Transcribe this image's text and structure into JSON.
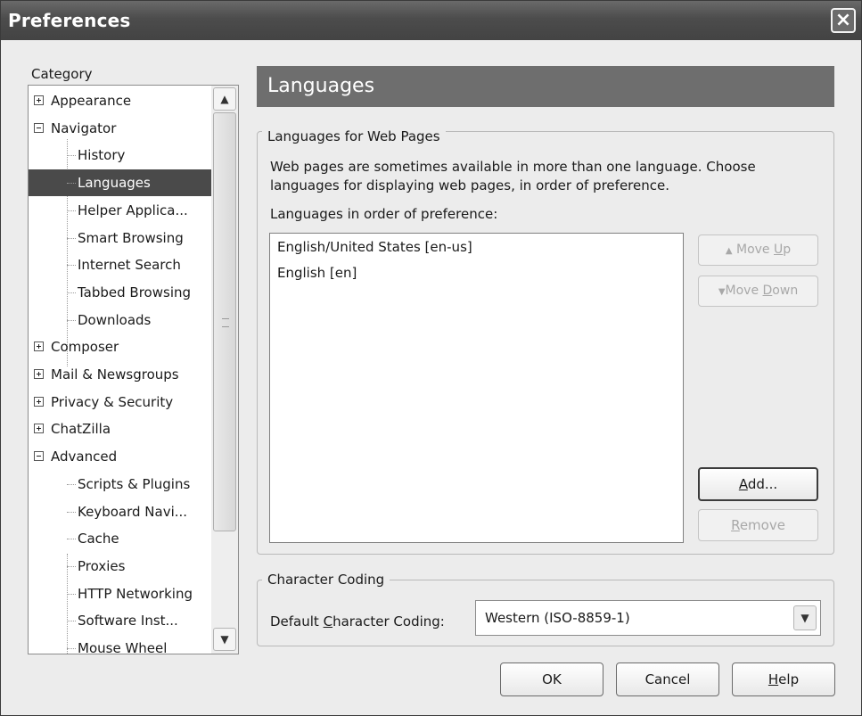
{
  "window": {
    "title": "Preferences",
    "close_glyph": "×"
  },
  "category": {
    "label": "Category",
    "tree": [
      {
        "label": "Appearance",
        "level": 0,
        "expander": "plus"
      },
      {
        "label": "Navigator",
        "level": 0,
        "expander": "minus"
      },
      {
        "label": "History",
        "level": 1
      },
      {
        "label": "Languages",
        "level": 1,
        "selected": true
      },
      {
        "label": "Helper Applica...",
        "level": 1
      },
      {
        "label": "Smart Browsing",
        "level": 1
      },
      {
        "label": "Internet Search",
        "level": 1
      },
      {
        "label": "Tabbed Browsing",
        "level": 1
      },
      {
        "label": "Downloads",
        "level": 1
      },
      {
        "label": "Composer",
        "level": 0,
        "expander": "plus"
      },
      {
        "label": "Mail & Newsgroups",
        "level": 0,
        "expander": "plus"
      },
      {
        "label": "Privacy & Security",
        "level": 0,
        "expander": "plus"
      },
      {
        "label": "ChatZilla",
        "level": 0,
        "expander": "plus"
      },
      {
        "label": "Advanced",
        "level": 0,
        "expander": "minus"
      },
      {
        "label": "Scripts & Plugins",
        "level": 1
      },
      {
        "label": "Keyboard Navi...",
        "level": 1
      },
      {
        "label": "Cache",
        "level": 1
      },
      {
        "label": "Proxies",
        "level": 1
      },
      {
        "label": "HTTP Networking",
        "level": 1
      },
      {
        "label": "Software Inst...",
        "level": 1
      },
      {
        "label": "Mouse Wheel",
        "level": 1
      }
    ],
    "scroll_up_glyph": "▲",
    "scroll_down_glyph": "▼"
  },
  "panel": {
    "title": "Languages",
    "web_pages_group": {
      "legend": "Languages for Web Pages",
      "description": "Web pages are sometimes available in more than one language. Choose languages for displaying web pages, in order of preference.",
      "list_label": "Languages in order of preference:",
      "languages": [
        "English/United States  [en-us]",
        "English  [en]"
      ],
      "move_up": {
        "glyph": "▲",
        "pre": " Move ",
        "key": "U",
        "post": "p"
      },
      "move_down": {
        "glyph": "▼",
        "pre": "Move ",
        "key": "D",
        "post": "own"
      },
      "add": {
        "key": "A",
        "post": "dd..."
      },
      "remove": {
        "key": "R",
        "post": "emove"
      }
    },
    "char_coding_group": {
      "legend": "Character Coding",
      "label_pre": "Default ",
      "label_key": "C",
      "label_post": "haracter Coding:",
      "selected": "Western (ISO-8859-1)",
      "dropdown_glyph": "▼"
    }
  },
  "footer": {
    "ok": "OK",
    "cancel": "Cancel",
    "help_key": "H",
    "help_post": "elp"
  }
}
